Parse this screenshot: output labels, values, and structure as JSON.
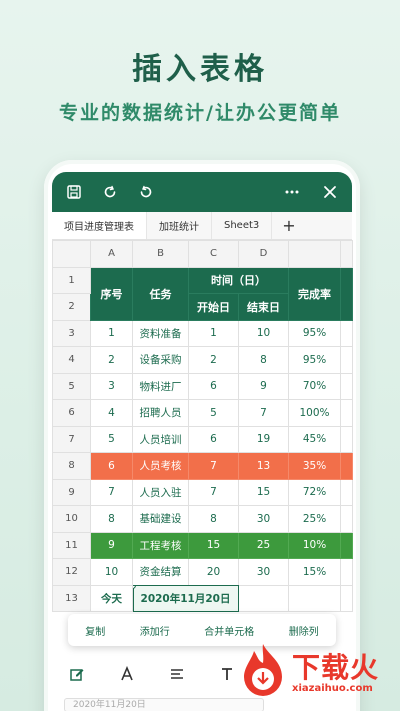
{
  "headline": "插入表格",
  "subline": "专业的数据统计/让办公更简单",
  "tabs": [
    {
      "label": "项目进度管理表"
    },
    {
      "label": "加班统计"
    },
    {
      "label": "Sheet3"
    }
  ],
  "tab_add": "+",
  "columns": [
    "A",
    "B",
    "C",
    "D",
    "E"
  ],
  "header": {
    "seq": "序号",
    "task": "任务",
    "time": "时间（日）",
    "start": "开始日",
    "end": "结束日",
    "rate": "完成率"
  },
  "row_numbers": [
    "1",
    "2",
    "3",
    "4",
    "5",
    "6",
    "7",
    "8",
    "9",
    "10",
    "11",
    "12",
    "13"
  ],
  "rows": [
    {
      "seq": "1",
      "task": "资料准备",
      "start": "1",
      "end": "10",
      "rate": "95%"
    },
    {
      "seq": "2",
      "task": "设备采购",
      "start": "2",
      "end": "8",
      "rate": "95%"
    },
    {
      "seq": "3",
      "task": "物料进厂",
      "start": "6",
      "end": "9",
      "rate": "70%"
    },
    {
      "seq": "4",
      "task": "招聘人员",
      "start": "5",
      "end": "7",
      "rate": "100%"
    },
    {
      "seq": "5",
      "task": "人员培训",
      "start": "6",
      "end": "19",
      "rate": "45%"
    },
    {
      "seq": "6",
      "task": "人员考核",
      "start": "7",
      "end": "13",
      "rate": "35%"
    },
    {
      "seq": "7",
      "task": "人员入驻",
      "start": "7",
      "end": "15",
      "rate": "72%"
    },
    {
      "seq": "8",
      "task": "基础建设",
      "start": "8",
      "end": "30",
      "rate": "25%"
    },
    {
      "seq": "9",
      "task": "工程考核",
      "start": "15",
      "end": "25",
      "rate": "10%"
    },
    {
      "seq": "10",
      "task": "资金结算",
      "start": "20",
      "end": "30",
      "rate": "15%"
    }
  ],
  "today_label": "今天",
  "today_value": "2020年11月20日",
  "context_menu": [
    "复制",
    "添加行",
    "合并单元格",
    "删除列"
  ],
  "formula_text": "2020年11月20日",
  "watermark": {
    "title": "下载火",
    "url": "xiazaihuo.com"
  },
  "colors": {
    "primary": "#1c6b4e",
    "red_row": "#f26f4a",
    "green_row": "#3d9a3d"
  }
}
